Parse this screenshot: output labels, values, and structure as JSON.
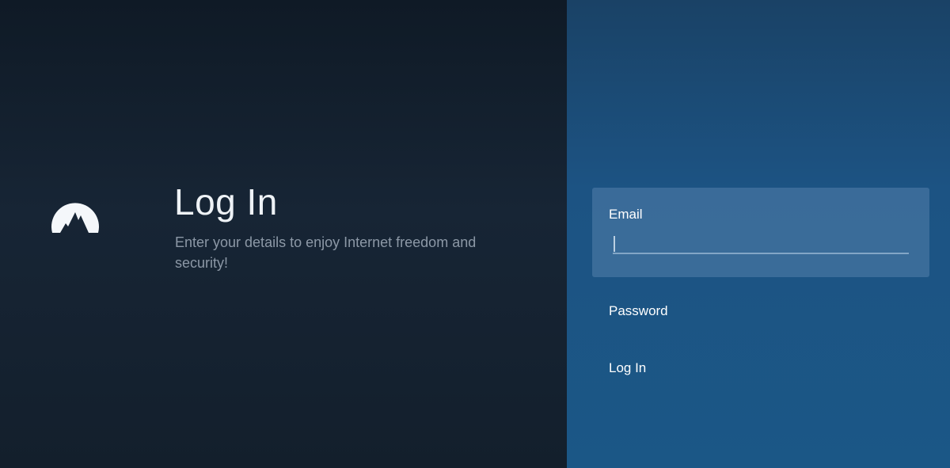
{
  "left": {
    "logo_icon": "mountain-logo-icon",
    "title": "Log In",
    "subtitle": "Enter your details to enjoy Internet freedom and security!"
  },
  "form": {
    "email_label": "Email",
    "email_value": "",
    "password_label": "Password",
    "login_label": "Log In"
  },
  "colors": {
    "left_background": "#152331",
    "right_background": "#1c5383",
    "focused_field": "#44759f",
    "text_primary": "#ffffff",
    "text_secondary": "#8c98a6"
  }
}
